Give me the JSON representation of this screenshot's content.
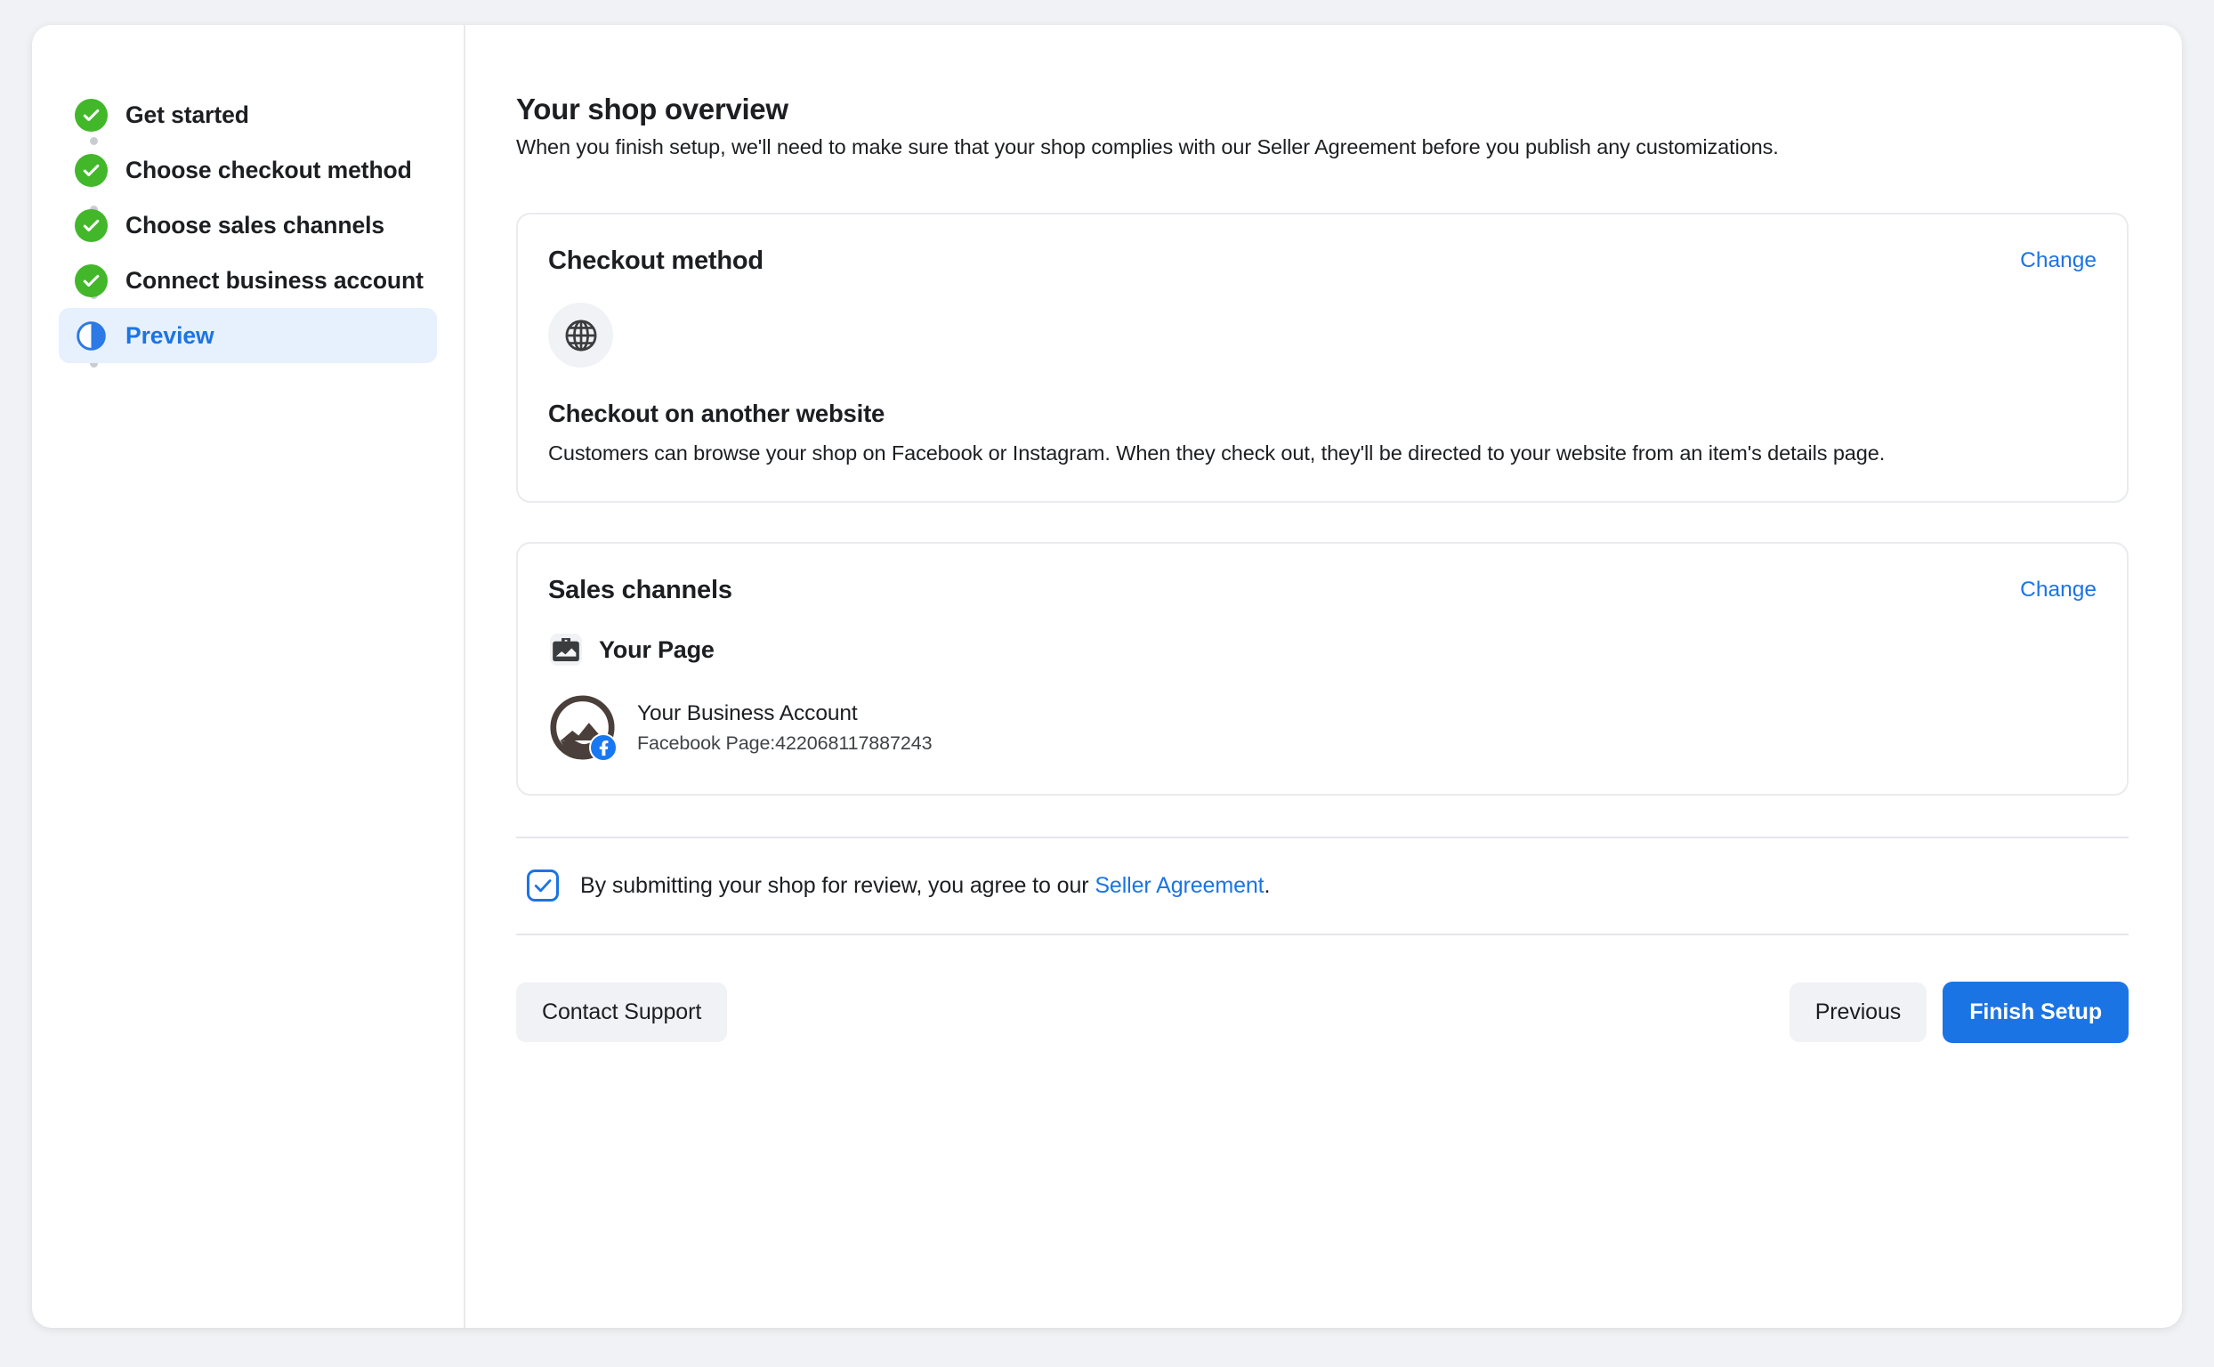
{
  "colors": {
    "accent_blue": "#1b74e4",
    "brand_blue": "#1877f2",
    "success_green": "#42b72a",
    "page_bg": "#f0f2f5",
    "active_step_bg": "#e7f0fd",
    "text_primary": "#1c1e21",
    "border": "#e4e6eb"
  },
  "sidebar": {
    "items": [
      {
        "label": "Get started",
        "state": "complete",
        "icon": "check-circle-icon"
      },
      {
        "label": "Choose checkout method",
        "state": "complete",
        "icon": "check-circle-icon"
      },
      {
        "label": "Choose sales channels",
        "state": "complete",
        "icon": "check-circle-icon"
      },
      {
        "label": "Connect business account",
        "state": "complete",
        "icon": "check-circle-icon"
      },
      {
        "label": "Preview",
        "state": "active",
        "icon": "half-circle-icon"
      }
    ]
  },
  "main": {
    "title": "Your shop overview",
    "subtitle": "When you finish setup, we'll need to make sure that your shop complies with our Seller Agreement before you publish any customizations.",
    "checkout_card": {
      "title": "Checkout method",
      "change_label": "Change",
      "icon": "globe-icon",
      "method_name": "Checkout on another website",
      "method_description": "Customers can browse your shop on Facebook or Instagram. When they check out, they'll be directed to your website from an item's details page."
    },
    "sales_card": {
      "title": "Sales channels",
      "change_label": "Change",
      "channel_icon": "briefcase-page-icon",
      "channel_label": "Your Page",
      "account": {
        "avatar_icon": "mountain-avatar-icon",
        "badge_icon": "facebook-badge-icon",
        "name": "Your Business Account",
        "meta": "Facebook Page:422068117887243"
      }
    },
    "agreement": {
      "checked": true,
      "text_before": "By submitting your shop for review, you agree to our ",
      "link_label": "Seller Agreement",
      "text_after": "."
    },
    "footer": {
      "contact_support_label": "Contact Support",
      "previous_label": "Previous",
      "finish_label": "Finish Setup"
    }
  }
}
